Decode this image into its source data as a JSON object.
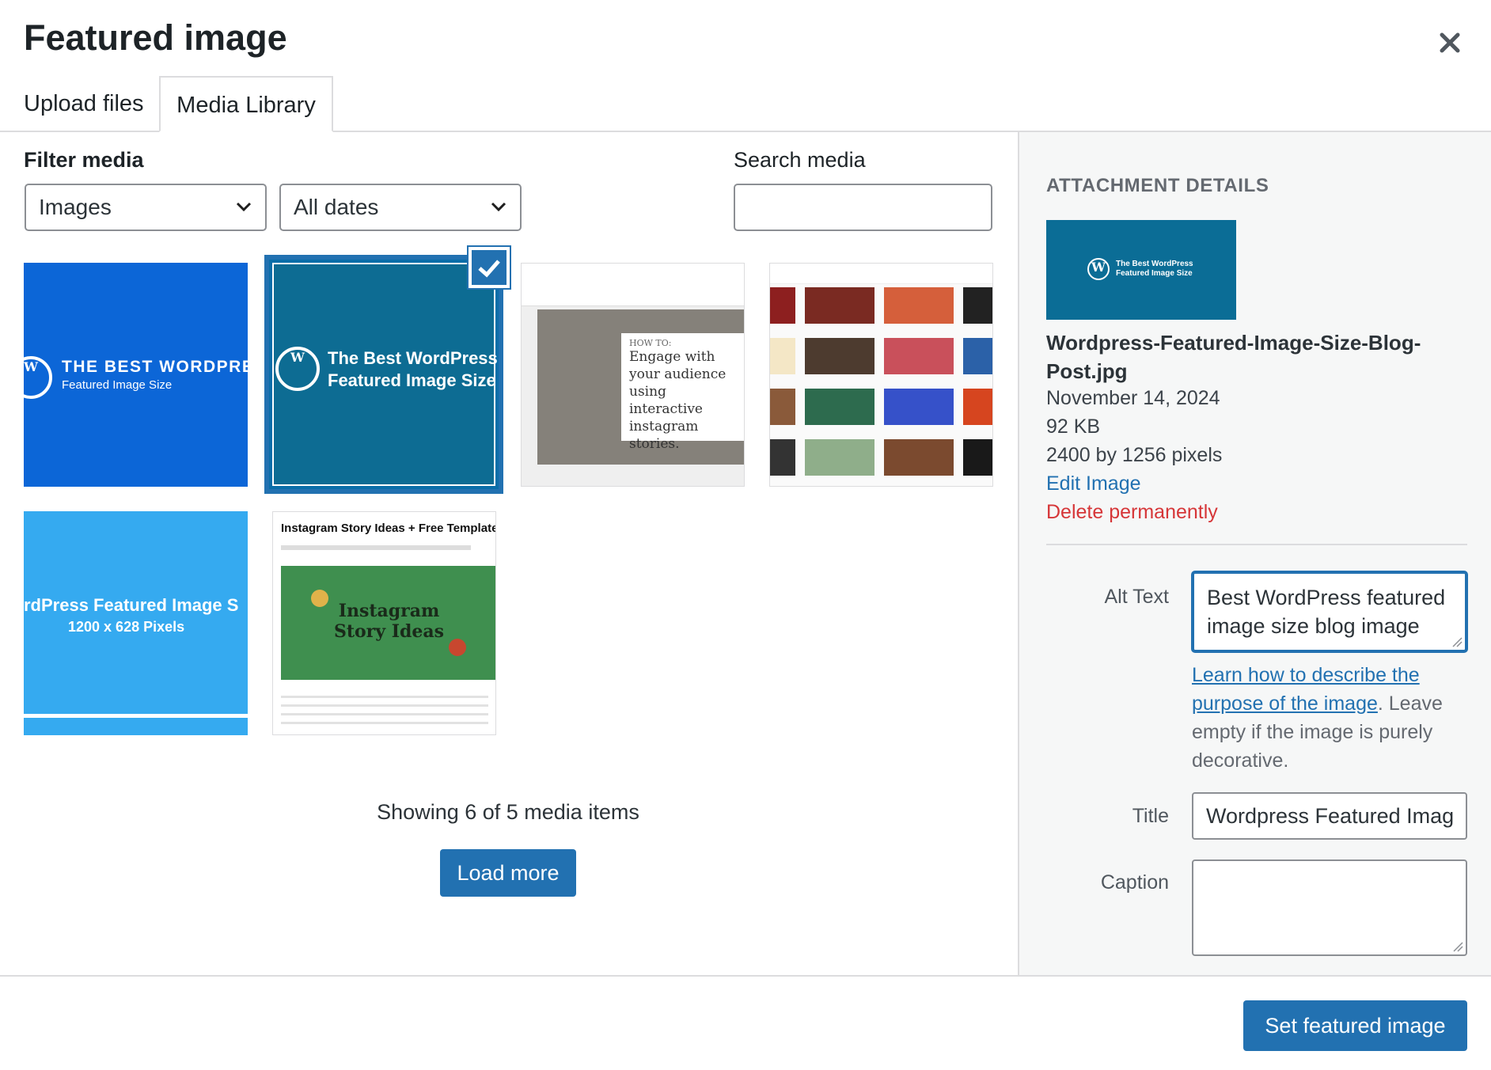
{
  "modal": {
    "title": "Featured image"
  },
  "tabs": [
    {
      "label": "Upload files"
    },
    {
      "label": "Media Library",
      "active": true
    }
  ],
  "filters": {
    "label": "Filter media",
    "type_value": "Images",
    "date_value": "All dates",
    "search_label": "Search media",
    "search_value": ""
  },
  "media_items": [
    {
      "texts": [
        "THE BEST WORDPRES",
        "Featured Image Size"
      ],
      "bg": "#0c66d7"
    },
    {
      "texts": [
        "The Best WordPress",
        "Featured Image Size"
      ],
      "bg": "#0d6c93",
      "selected": true
    },
    {
      "texts": [
        "HOW TO:",
        "Engage with",
        "your audience",
        "using interactive",
        "instagram stories."
      ]
    },
    {
      "texts": []
    },
    {
      "texts": [
        "rdPress Featured Image S",
        "1200 x 628 Pixels"
      ],
      "bg": "#35aaf0"
    },
    {
      "texts": [
        "Instagram Story Ideas + Free Templates",
        "Instagram",
        "Story Ideas"
      ]
    }
  ],
  "library": {
    "showing_text": "Showing 6 of 5 media items",
    "load_more": "Load more"
  },
  "attachment": {
    "heading": "ATTACHMENT DETAILS",
    "thumb_texts": [
      "The Best WordPress",
      "Featured Image Size"
    ],
    "filename": "Wordpress-Featured-Image-Size-Blog-Post.jpg",
    "date": "November 14, 2024",
    "size": "92 KB",
    "dimensions": "2400 by 1256 pixels",
    "edit_link": "Edit Image",
    "delete_link": "Delete permanently"
  },
  "fields": {
    "alt_label": "Alt Text",
    "alt_value": "Best WordPress featured image size blog image",
    "help_link": "Learn how to describe the purpose of the image",
    "help_rest": ". Leave empty if the image is purely decorative.",
    "title_label": "Title",
    "title_value": "Wordpress Featured Imag",
    "caption_label": "Caption",
    "caption_value": ""
  },
  "footer": {
    "primary_button": "Set featured image"
  },
  "colors": {
    "accent": "#2271b1",
    "danger": "#d63638"
  }
}
